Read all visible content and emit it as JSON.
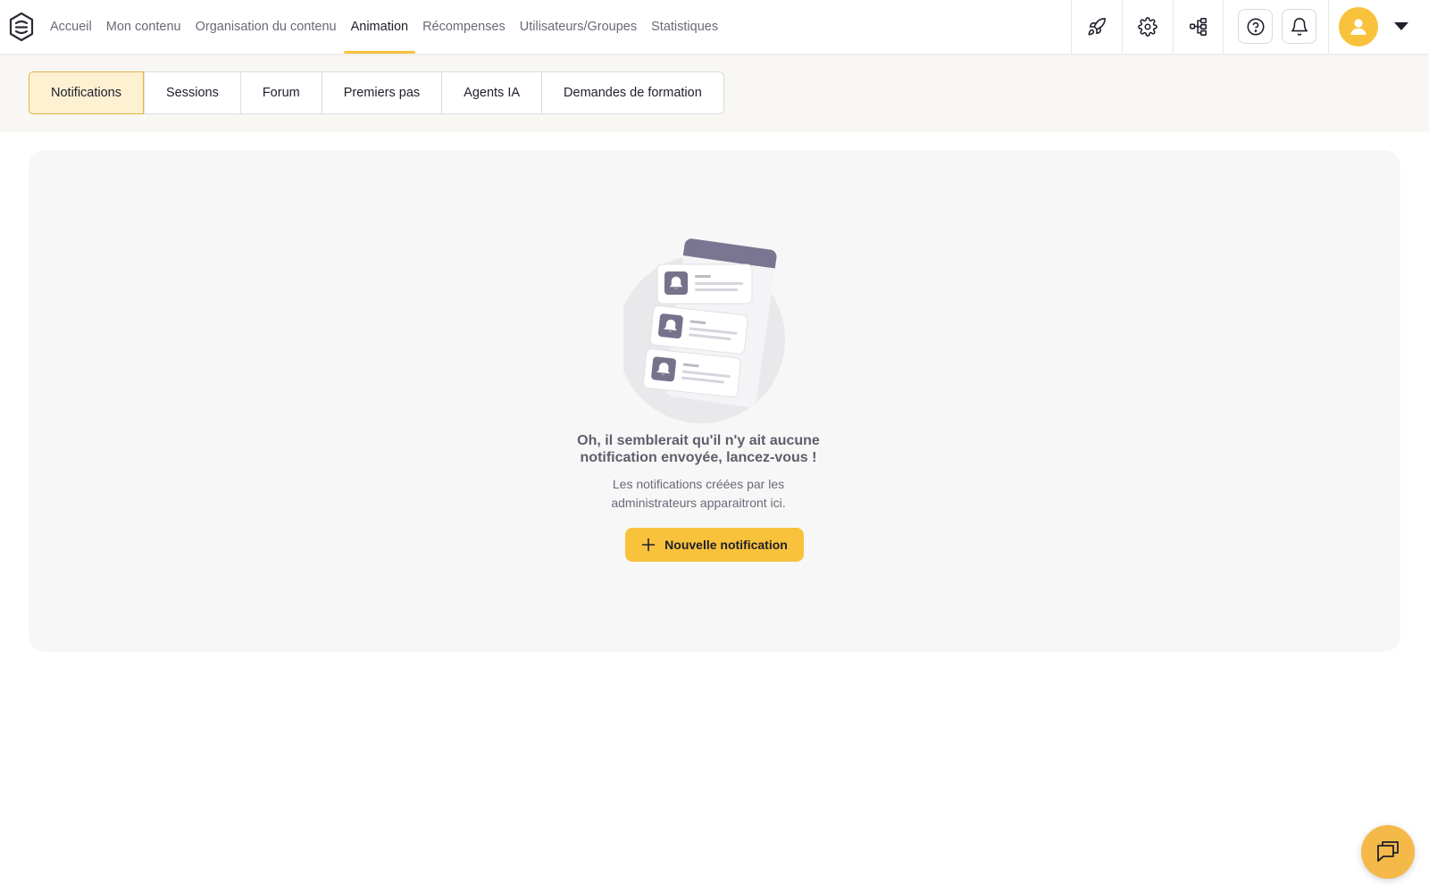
{
  "nav": {
    "items": [
      {
        "label": "Accueil",
        "active": false
      },
      {
        "label": "Mon contenu",
        "active": false
      },
      {
        "label": "Organisation du contenu",
        "active": false
      },
      {
        "label": "Animation",
        "active": true
      },
      {
        "label": "Récompenses",
        "active": false
      },
      {
        "label": "Utilisateurs/Groupes",
        "active": false
      },
      {
        "label": "Statistiques",
        "active": false
      }
    ]
  },
  "toolbar": {
    "icons": [
      "rocket-icon",
      "gear-icon",
      "hierarchy-icon",
      "help-icon",
      "bell-icon",
      "user-icon",
      "caret-down-icon"
    ]
  },
  "tabs": [
    {
      "label": "Notifications",
      "active": true
    },
    {
      "label": "Sessions",
      "active": false
    },
    {
      "label": "Forum",
      "active": false
    },
    {
      "label": "Premiers pas",
      "active": false
    },
    {
      "label": "Agents IA",
      "active": false
    },
    {
      "label": "Demandes de formation",
      "active": false
    }
  ],
  "empty_state": {
    "title": "Oh, il semblerait qu'il n'y ait aucune notification envoyée, lancez-vous !",
    "description": "Les notifications créées par les administrateurs apparaitront ici.",
    "button_label": "Nouvelle notification"
  },
  "colors": {
    "accent": "#f9c23c",
    "active_tab_bg": "#fdf1d2",
    "panel_bg": "#f7f7f7"
  }
}
